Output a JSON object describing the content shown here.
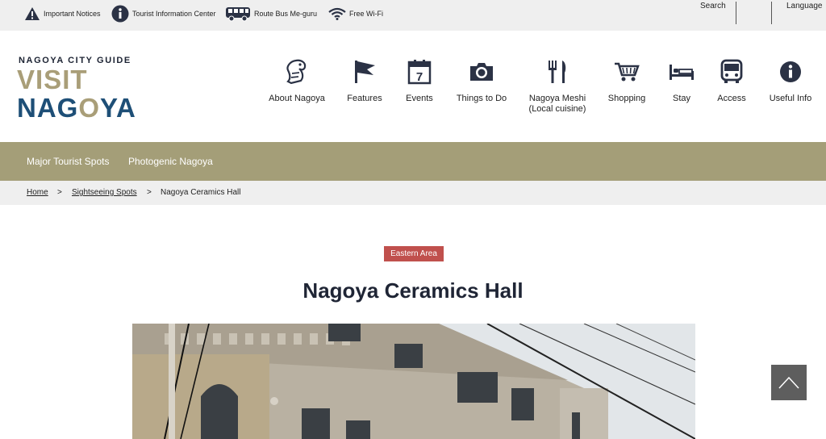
{
  "utility": {
    "important_notices": "Important Notices",
    "tourist_info": "Tourist Information Center",
    "route_bus": "Route Bus Me-guru",
    "free_wifi": "Free Wi-Fi",
    "search": "Search",
    "language": "Language"
  },
  "logo": {
    "subtitle": "NAGOYA CITY GUIDE",
    "visit": "VISIT",
    "nagoya_pre": "NAG",
    "nagoya_o": "O",
    "nagoya_post": "YA"
  },
  "nav": [
    {
      "label": "About Nagoya",
      "icon": "shachihoko-icon"
    },
    {
      "label": "Features",
      "icon": "flag-icon"
    },
    {
      "label": "Events",
      "icon": "calendar-icon",
      "day": "7"
    },
    {
      "label": "Things to Do",
      "icon": "camera-icon"
    },
    {
      "label": "Nagoya Meshi\n(Local cuisine)",
      "icon": "fork-knife-icon"
    },
    {
      "label": "Shopping",
      "icon": "cart-icon"
    },
    {
      "label": "Stay",
      "icon": "bed-icon"
    },
    {
      "label": "Access",
      "icon": "bus-icon"
    },
    {
      "label": "Useful Info",
      "icon": "info-icon"
    }
  ],
  "subnav": {
    "major": "Major Tourist Spots",
    "photogenic": "Photogenic Nagoya"
  },
  "breadcrumb": {
    "home": "Home",
    "sightseeing": "Sightseeing Spots",
    "current": "Nagoya Ceramics Hall",
    "separator": ">"
  },
  "page": {
    "area_badge": "Eastern Area",
    "title": "Nagoya Ceramics Hall"
  },
  "colors": {
    "accent_gold": "#a49e78",
    "navy": "#1e4f77",
    "badge_red": "#c0504d"
  }
}
